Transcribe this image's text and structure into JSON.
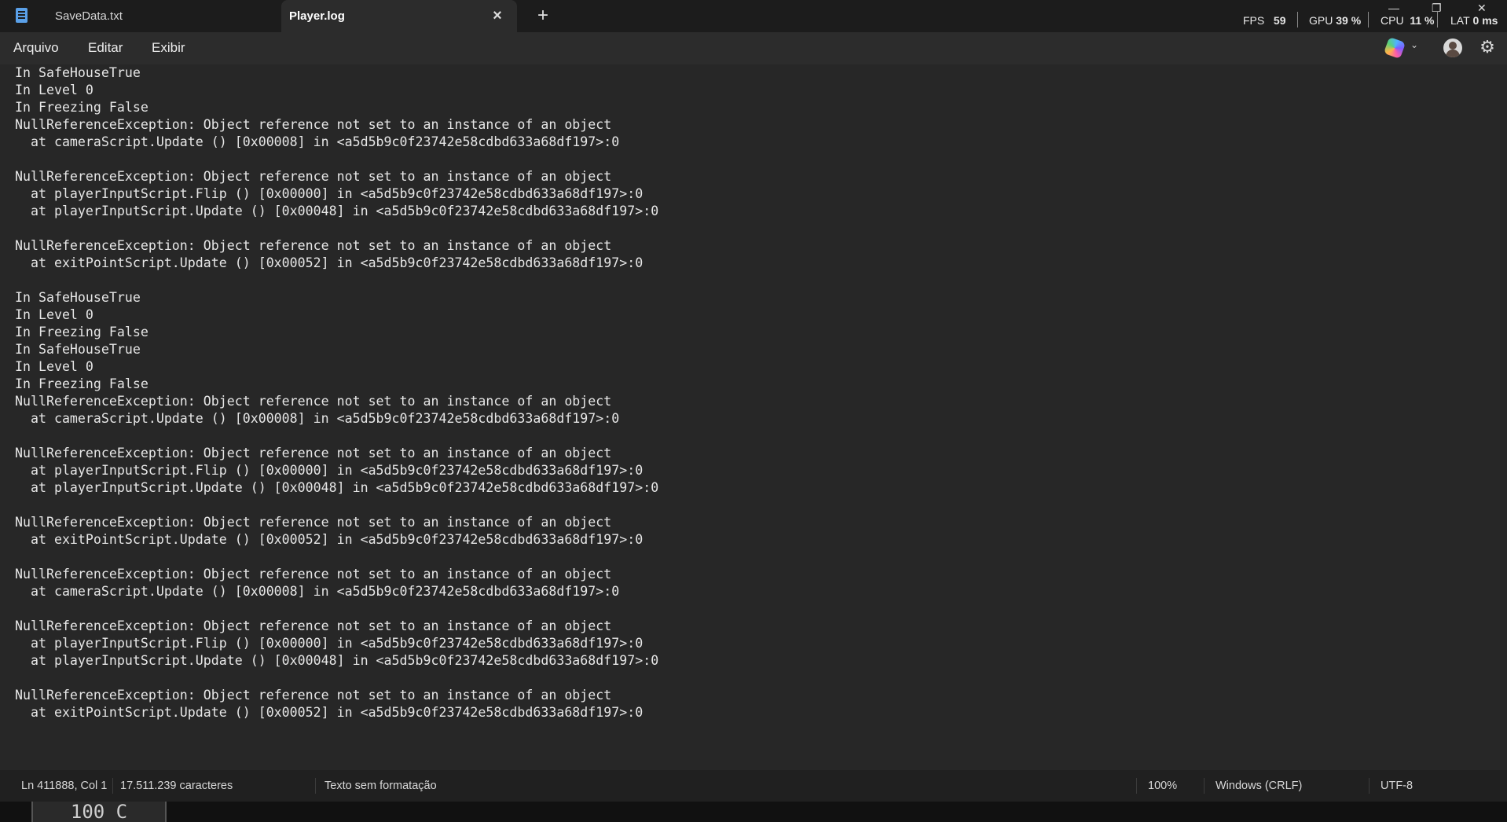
{
  "tabs": [
    {
      "label": "SaveData.txt",
      "active": false
    },
    {
      "label": "Player.log",
      "active": true
    }
  ],
  "tab_close_icon": "close-icon",
  "new_tab_symbol": "+",
  "perf_overlay": {
    "fps_label": "FPS",
    "fps_value": "59",
    "gpu_label": "GPU",
    "gpu_value": "39 %",
    "cpu_label": "CPU",
    "cpu_value": "11 %",
    "lat_label": "LAT",
    "lat_value": "0 ms"
  },
  "menu": {
    "file": "Arquivo",
    "edit": "Editar",
    "view": "Exibir"
  },
  "editor": {
    "lines": [
      "In SafeHouseTrue",
      "In Level 0",
      "In Freezing False",
      "NullReferenceException: Object reference not set to an instance of an object",
      "  at cameraScript.Update () [0x00008] in <a5d5b9c0f23742e58cdbd633a68df197>:0",
      "",
      "NullReferenceException: Object reference not set to an instance of an object",
      "  at playerInputScript.Flip () [0x00000] in <a5d5b9c0f23742e58cdbd633a68df197>:0",
      "  at playerInputScript.Update () [0x00048] in <a5d5b9c0f23742e58cdbd633a68df197>:0",
      "",
      "NullReferenceException: Object reference not set to an instance of an object",
      "  at exitPointScript.Update () [0x00052] in <a5d5b9c0f23742e58cdbd633a68df197>:0",
      "",
      "In SafeHouseTrue",
      "In Level 0",
      "In Freezing False",
      "In SafeHouseTrue",
      "In Level 0",
      "In Freezing False",
      "NullReferenceException: Object reference not set to an instance of an object",
      "  at cameraScript.Update () [0x00008] in <a5d5b9c0f23742e58cdbd633a68df197>:0",
      "",
      "NullReferenceException: Object reference not set to an instance of an object",
      "  at playerInputScript.Flip () [0x00000] in <a5d5b9c0f23742e58cdbd633a68df197>:0",
      "  at playerInputScript.Update () [0x00048] in <a5d5b9c0f23742e58cdbd633a68df197>:0",
      "",
      "NullReferenceException: Object reference not set to an instance of an object",
      "  at exitPointScript.Update () [0x00052] in <a5d5b9c0f23742e58cdbd633a68df197>:0",
      "",
      "NullReferenceException: Object reference not set to an instance of an object",
      "  at cameraScript.Update () [0x00008] in <a5d5b9c0f23742e58cdbd633a68df197>:0",
      "",
      "NullReferenceException: Object reference not set to an instance of an object",
      "  at playerInputScript.Flip () [0x00000] in <a5d5b9c0f23742e58cdbd633a68df197>:0",
      "  at playerInputScript.Update () [0x00048] in <a5d5b9c0f23742e58cdbd633a68df197>:0",
      "",
      "NullReferenceException: Object reference not set to an instance of an object",
      "  at exitPointScript.Update () [0x00052] in <a5d5b9c0f23742e58cdbd633a68df197>:0"
    ]
  },
  "status": {
    "position": "Ln 411888, Col 1",
    "char_count": "17.511.239 caracteres",
    "format": "Texto sem formatação",
    "zoom": "100%",
    "line_ending": "Windows (CRLF)",
    "encoding": "UTF-8"
  },
  "background_fragment": "100 C"
}
